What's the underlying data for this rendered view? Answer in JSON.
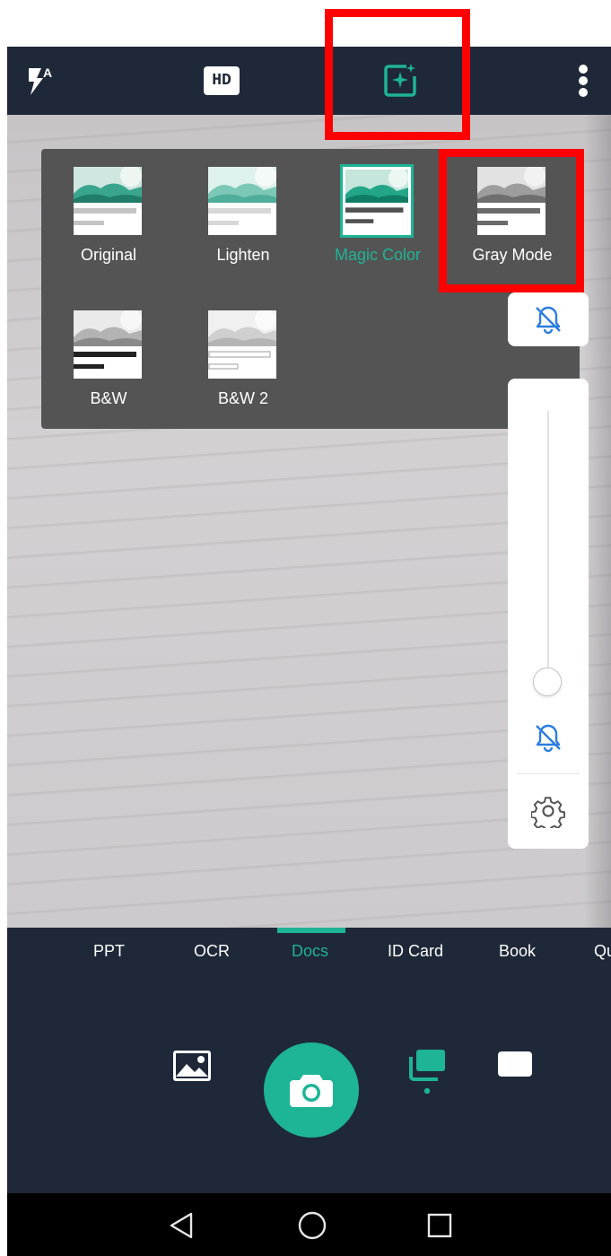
{
  "top_bar": {
    "flash_icon": "flash-auto-icon",
    "hd_label": "HD",
    "filter_icon": "magic-filter-icon",
    "more_icon": "more-vert-icon"
  },
  "filters": [
    {
      "label": "Original",
      "selected": false
    },
    {
      "label": "Lighten",
      "selected": false
    },
    {
      "label": "Magic Color",
      "selected": true
    },
    {
      "label": "Gray Mode",
      "selected": false
    },
    {
      "label": "B&W",
      "selected": false
    },
    {
      "label": "B&W 2",
      "selected": false
    }
  ],
  "side_controls": {
    "mute_icon": "bell-off-icon",
    "zoom_level": 0,
    "zoom_bell_icon": "bell-off-icon",
    "settings_icon": "gear-icon"
  },
  "modes": [
    "PPT",
    "OCR",
    "Docs",
    "ID Card",
    "Book",
    "Qu"
  ],
  "active_mode": "Docs",
  "colors": {
    "accent": "#1eb496",
    "bar_bg": "#1f2838",
    "panel_bg": "#545454",
    "highlight": "#ff0000"
  },
  "bottom_controls": {
    "gallery_icon": "image-icon",
    "shutter_icon": "camera-icon",
    "batch_icon": "batch-mode-icon",
    "single_icon": "single-mode-icon"
  },
  "nav": {
    "back_icon": "back-triangle-icon",
    "home_icon": "home-circle-icon",
    "recents_icon": "recents-square-icon"
  }
}
